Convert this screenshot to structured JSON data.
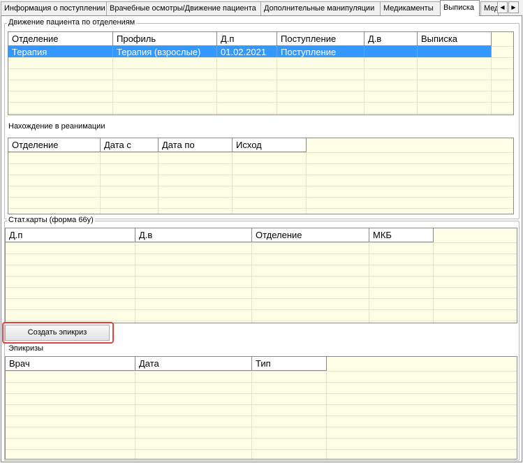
{
  "tabs": [
    {
      "label": "Информация о поступлении"
    },
    {
      "label": "Врачебные осмотры/Движение пациента"
    },
    {
      "label": "Дополнительные манипуляции"
    },
    {
      "label": "Медикаменты"
    },
    {
      "label": "Выписка",
      "active": true
    },
    {
      "label": "Мед"
    }
  ],
  "tab_scroll": {
    "left_icon": "◀",
    "right_icon": "▶"
  },
  "movement": {
    "legend": "Движение пациента по отделениям",
    "columns": [
      "Отделение",
      "Профиль",
      "Д.п",
      "Поступление",
      "Д.в",
      "Выписка"
    ],
    "rows": [
      {
        "cells": [
          "Терапия",
          "Терапия (взрослые)",
          "01.02.2021",
          "Поступление",
          "",
          ""
        ],
        "selected": true
      }
    ]
  },
  "icu": {
    "caption": "Нахождение в реанимации",
    "columns": [
      "Отделение",
      "Дата с",
      "Дата по",
      "Исход"
    ],
    "rows": []
  },
  "stat_cards": {
    "legend": "Стат.карты (форма 66у)",
    "columns": [
      "Д.п",
      "Д.в",
      "Отделение",
      "МКБ"
    ],
    "rows": []
  },
  "create_epicrisis_button": "Создать эпикриз",
  "epicrises": {
    "legend": "Эпикризы",
    "columns": [
      "Врач",
      "Дата",
      "Тип"
    ],
    "rows": []
  },
  "colors": {
    "selection": "#3399ff",
    "grid_bg": "#fefee6",
    "highlight": "#e0403e"
  }
}
